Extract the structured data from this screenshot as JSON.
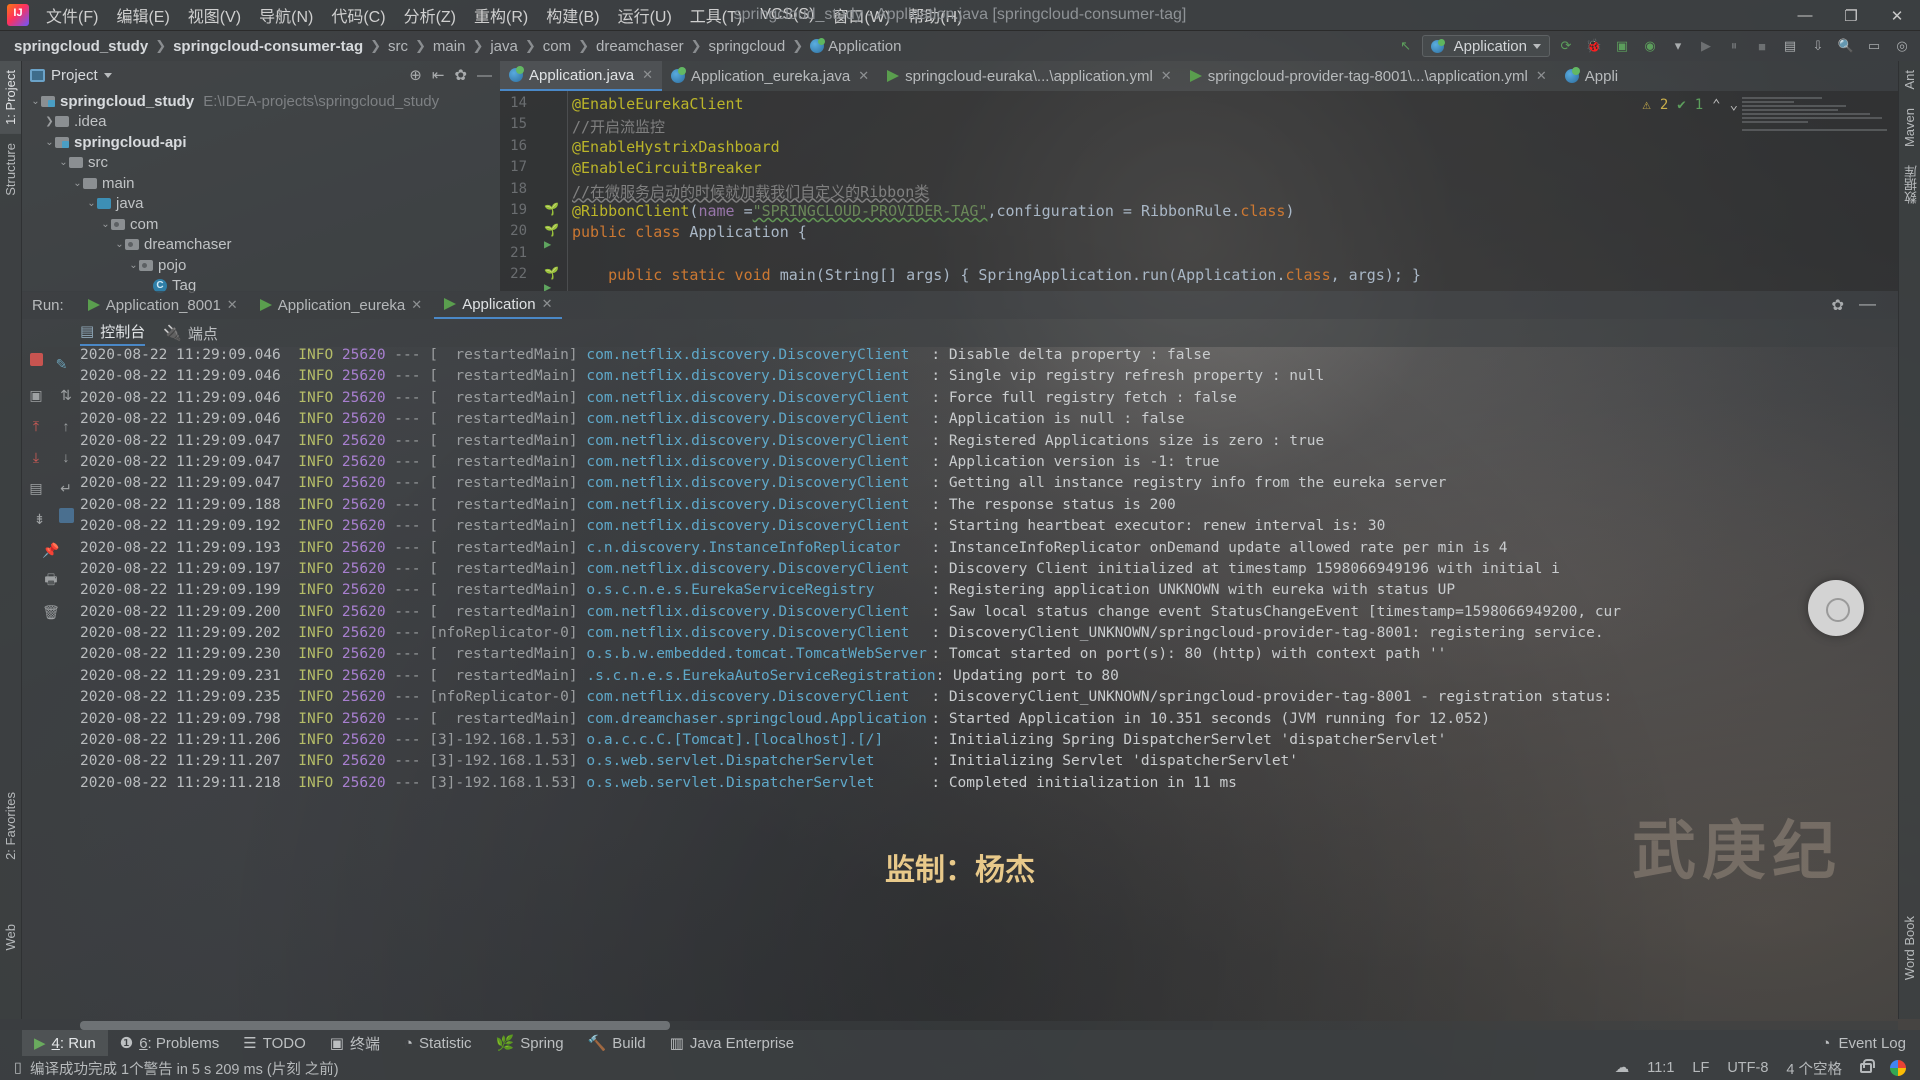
{
  "menubar": {
    "logo": "intellij-logo",
    "items": [
      "文件(F)",
      "编辑(E)",
      "视图(V)",
      "导航(N)",
      "代码(C)",
      "分析(Z)",
      "重构(R)",
      "构建(B)",
      "运行(U)",
      "工具(T)",
      "VCS(S)",
      "窗口(W)",
      "帮助(H)"
    ],
    "window_title": "springcloud_study - Application.java [springcloud-consumer-tag]",
    "window_controls": [
      "—",
      "❐",
      "✕"
    ]
  },
  "navbar": {
    "crumbs": [
      "springcloud_study",
      "springcloud-consumer-tag",
      "src",
      "main",
      "java",
      "com",
      "dreamchaser",
      "springcloud",
      "Application"
    ],
    "separator": "❯",
    "run_config": "Application",
    "toolbar_icons": [
      "back-arrow-icon",
      "rerun-icon",
      "debug-icon",
      "coverage-icon",
      "profile-icon",
      "run-icon",
      "pause-icon",
      "stop-icon",
      "layout-icon",
      "search-icon",
      "settings-icon",
      "help-icon"
    ]
  },
  "left_strip": {
    "tabs": [
      "1: Project",
      "Structure",
      "2: Favorites",
      "Web"
    ]
  },
  "right_strip": {
    "tabs": [
      "Ant",
      "Maven",
      "数据库",
      "Word Book"
    ]
  },
  "project_panel": {
    "title": "Project",
    "header_icons": [
      "locate-icon",
      "collapse-all-icon",
      "settings-icon",
      "hide-icon"
    ],
    "tree": [
      {
        "depth": 0,
        "arrow": "⌄",
        "icon": "module-folder",
        "label": "springcloud_study",
        "bold": true,
        "path": "E:\\IDEA-projects\\springcloud_study"
      },
      {
        "depth": 1,
        "arrow": "❯",
        "icon": "folder",
        "label": ".idea",
        "bold": false,
        "path": ""
      },
      {
        "depth": 1,
        "arrow": "⌄",
        "icon": "module-folder",
        "label": "springcloud-api",
        "bold": true,
        "path": ""
      },
      {
        "depth": 2,
        "arrow": "⌄",
        "icon": "folder",
        "label": "src",
        "bold": false,
        "path": ""
      },
      {
        "depth": 3,
        "arrow": "⌄",
        "icon": "folder",
        "label": "main",
        "bold": false,
        "path": ""
      },
      {
        "depth": 4,
        "arrow": "⌄",
        "icon": "source-folder",
        "label": "java",
        "bold": false,
        "path": ""
      },
      {
        "depth": 5,
        "arrow": "⌄",
        "icon": "package",
        "label": "com",
        "bold": false,
        "path": ""
      },
      {
        "depth": 6,
        "arrow": "⌄",
        "icon": "package",
        "label": "dreamchaser",
        "bold": false,
        "path": ""
      },
      {
        "depth": 7,
        "arrow": "⌄",
        "icon": "package",
        "label": "pojo",
        "bold": false,
        "path": ""
      },
      {
        "depth": 8,
        "arrow": "",
        "icon": "class",
        "label": "Tag",
        "bold": false,
        "path": ""
      }
    ]
  },
  "editor_tabs": [
    {
      "label": "Application.java",
      "icon": "java-class-icon",
      "selected": true,
      "closable": true
    },
    {
      "label": "Application_eureka.java",
      "icon": "java-class-icon",
      "selected": false,
      "closable": true
    },
    {
      "label": "springcloud-euraka\\...\\application.yml",
      "icon": "yaml-icon",
      "selected": false,
      "closable": true
    },
    {
      "label": "springcloud-provider-tag-8001\\...\\application.yml",
      "icon": "yaml-icon",
      "selected": false,
      "closable": true
    },
    {
      "label": "Appli",
      "icon": "java-class-icon",
      "selected": false,
      "closable": false
    }
  ],
  "editor": {
    "inspection": {
      "warnings": "2",
      "oks": "1",
      "warn_icon": "warning-triangle-icon",
      "ok_icon": "check-icon",
      "up_icon": "⌃",
      "down_icon": "⌄"
    },
    "lines": [
      {
        "num": "14",
        "gutter": "",
        "tokens": [
          {
            "t": "@EnableEurekaClient",
            "c": "ann"
          }
        ]
      },
      {
        "num": "15",
        "gutter": "",
        "tokens": [
          {
            "t": "//开启流监控",
            "c": "cmt"
          }
        ]
      },
      {
        "num": "16",
        "gutter": "",
        "tokens": [
          {
            "t": "@EnableHystrixDashboard",
            "c": "ann"
          }
        ]
      },
      {
        "num": "17",
        "gutter": "",
        "tokens": [
          {
            "t": "@EnableCircuitBreaker",
            "c": "ann"
          }
        ]
      },
      {
        "num": "18",
        "gutter": "",
        "tokens": [
          {
            "t": "//在微服务启动的时候就加载我们自定义的Ribbon类",
            "c": "cmt-u"
          }
        ]
      },
      {
        "num": "19",
        "gutter": "bean-icon",
        "tokens": [
          {
            "t": "@RibbonClient",
            "c": "ann"
          },
          {
            "t": "(",
            "c": "pln"
          },
          {
            "t": "name ",
            "c": "fld"
          },
          {
            "t": "=",
            "c": "pln"
          },
          {
            "t": "\"SPRINGCLOUD-PROVIDER-TAG\"",
            "c": "str sq-und"
          },
          {
            "t": ",",
            "c": "pln"
          },
          {
            "t": "configuration = ",
            "c": "pln"
          },
          {
            "t": "RibbonRule",
            "c": "pln"
          },
          {
            "t": ".",
            "c": "pln"
          },
          {
            "t": "class",
            "c": "kw"
          },
          {
            "t": ")",
            "c": "pln"
          }
        ]
      },
      {
        "num": "20",
        "gutter": "run-icon",
        "tokens": [
          {
            "t": "public class ",
            "c": "kw"
          },
          {
            "t": "Application",
            "c": "pln"
          },
          {
            "t": " {",
            "c": "pln"
          }
        ]
      },
      {
        "num": "21",
        "gutter": "",
        "tokens": []
      },
      {
        "num": "22",
        "gutter": "run-icon",
        "tokens": [
          {
            "t": "    public static void ",
            "c": "kw"
          },
          {
            "t": "main",
            "c": "cls2"
          },
          {
            "t": "(",
            "c": "pln"
          },
          {
            "t": "String",
            "c": "pln"
          },
          {
            "t": "[] args) { ",
            "c": "pln"
          },
          {
            "t": "SpringApplication",
            "c": "pln"
          },
          {
            "t": ".",
            "c": "pln"
          },
          {
            "t": "run",
            "c": "cls2"
          },
          {
            "t": "(",
            "c": "pln"
          },
          {
            "t": "Application",
            "c": "pln"
          },
          {
            "t": ".",
            "c": "pln"
          },
          {
            "t": "class",
            "c": "kw"
          },
          {
            "t": ", args); }",
            "c": "pln"
          }
        ]
      }
    ]
  },
  "run_panel": {
    "label": "Run:",
    "tabs": [
      {
        "label": "Application_8001",
        "icon": "run-tab-icon",
        "selected": false
      },
      {
        "label": "Application_eureka",
        "icon": "run-tab-icon",
        "selected": false
      },
      {
        "label": "Application",
        "icon": "run-tab-icon",
        "selected": true
      }
    ],
    "settings_icon": "gear-icon",
    "minimize_icon": "minimize-icon",
    "subtabs": [
      {
        "label": "控制台",
        "icon": "console-icon",
        "selected": true
      },
      {
        "label": "端点",
        "icon": "endpoints-icon",
        "selected": false
      }
    ],
    "side_icons": [
      "rerun-icon",
      "edit-icon",
      "stop-icon",
      "sort-icon",
      "camera-icon",
      "up-arrow-icon",
      "export-icon",
      "down-arrow-icon",
      "import-icon",
      "scroll-end-icon",
      "layout-icon",
      "wrap-icon",
      "pin-icon",
      "print-icon",
      "trash-icon"
    ]
  },
  "console_logs": [
    {
      "date": "2020-08-22 11:29:09.046",
      "level": "INFO",
      "pid": "25620",
      "thread": "[  restartedMain]",
      "logger": "com.netflix.discovery.DiscoveryClient",
      "msg": ": Disable delta property : false"
    },
    {
      "date": "2020-08-22 11:29:09.046",
      "level": "INFO",
      "pid": "25620",
      "thread": "[  restartedMain]",
      "logger": "com.netflix.discovery.DiscoveryClient",
      "msg": ": Single vip registry refresh property : null"
    },
    {
      "date": "2020-08-22 11:29:09.046",
      "level": "INFO",
      "pid": "25620",
      "thread": "[  restartedMain]",
      "logger": "com.netflix.discovery.DiscoveryClient",
      "msg": ": Force full registry fetch : false"
    },
    {
      "date": "2020-08-22 11:29:09.046",
      "level": "INFO",
      "pid": "25620",
      "thread": "[  restartedMain]",
      "logger": "com.netflix.discovery.DiscoveryClient",
      "msg": ": Application is null : false"
    },
    {
      "date": "2020-08-22 11:29:09.047",
      "level": "INFO",
      "pid": "25620",
      "thread": "[  restartedMain]",
      "logger": "com.netflix.discovery.DiscoveryClient",
      "msg": ": Registered Applications size is zero : true"
    },
    {
      "date": "2020-08-22 11:29:09.047",
      "level": "INFO",
      "pid": "25620",
      "thread": "[  restartedMain]",
      "logger": "com.netflix.discovery.DiscoveryClient",
      "msg": ": Application version is -1: true"
    },
    {
      "date": "2020-08-22 11:29:09.047",
      "level": "INFO",
      "pid": "25620",
      "thread": "[  restartedMain]",
      "logger": "com.netflix.discovery.DiscoveryClient",
      "msg": ": Getting all instance registry info from the eureka server"
    },
    {
      "date": "2020-08-22 11:29:09.188",
      "level": "INFO",
      "pid": "25620",
      "thread": "[  restartedMain]",
      "logger": "com.netflix.discovery.DiscoveryClient",
      "msg": ": The response status is 200"
    },
    {
      "date": "2020-08-22 11:29:09.192",
      "level": "INFO",
      "pid": "25620",
      "thread": "[  restartedMain]",
      "logger": "com.netflix.discovery.DiscoveryClient",
      "msg": ": Starting heartbeat executor: renew interval is: 30"
    },
    {
      "date": "2020-08-22 11:29:09.193",
      "level": "INFO",
      "pid": "25620",
      "thread": "[  restartedMain]",
      "logger": "c.n.discovery.InstanceInfoReplicator",
      "msg": ": InstanceInfoReplicator onDemand update allowed rate per min is 4"
    },
    {
      "date": "2020-08-22 11:29:09.197",
      "level": "INFO",
      "pid": "25620",
      "thread": "[  restartedMain]",
      "logger": "com.netflix.discovery.DiscoveryClient",
      "msg": ": Discovery Client initialized at timestamp 1598066949196 with initial i"
    },
    {
      "date": "2020-08-22 11:29:09.199",
      "level": "INFO",
      "pid": "25620",
      "thread": "[  restartedMain]",
      "logger": "o.s.c.n.e.s.EurekaServiceRegistry",
      "msg": ": Registering application UNKNOWN with eureka with status UP"
    },
    {
      "date": "2020-08-22 11:29:09.200",
      "level": "INFO",
      "pid": "25620",
      "thread": "[  restartedMain]",
      "logger": "com.netflix.discovery.DiscoveryClient",
      "msg": ": Saw local status change event StatusChangeEvent [timestamp=1598066949200, cur"
    },
    {
      "date": "2020-08-22 11:29:09.202",
      "level": "INFO",
      "pid": "25620",
      "thread": "[nfoReplicator-0]",
      "logger": "com.netflix.discovery.DiscoveryClient",
      "msg": ": DiscoveryClient_UNKNOWN/springcloud-provider-tag-8001: registering service."
    },
    {
      "date": "2020-08-22 11:29:09.230",
      "level": "INFO",
      "pid": "25620",
      "thread": "[  restartedMain]",
      "logger": "o.s.b.w.embedded.tomcat.TomcatWebServer",
      "msg": ": Tomcat started on port(s): 80 (http) with context path ''"
    },
    {
      "date": "2020-08-22 11:29:09.231",
      "level": "INFO",
      "pid": "25620",
      "thread": "[  restartedMain]",
      "logger": ".s.c.n.e.s.EurekaAutoServiceRegistration",
      "msg": ": Updating port to 80"
    },
    {
      "date": "2020-08-22 11:29:09.235",
      "level": "INFO",
      "pid": "25620",
      "thread": "[nfoReplicator-0]",
      "logger": "com.netflix.discovery.DiscoveryClient",
      "msg": ": DiscoveryClient_UNKNOWN/springcloud-provider-tag-8001 - registration status:"
    },
    {
      "date": "2020-08-22 11:29:09.798",
      "level": "INFO",
      "pid": "25620",
      "thread": "[  restartedMain]",
      "logger": "com.dreamchaser.springcloud.Application",
      "msg": ": Started Application in 10.351 seconds (JVM running for 12.052)"
    },
    {
      "date": "2020-08-22 11:29:11.206",
      "level": "INFO",
      "pid": "25620",
      "thread": "[3]-192.168.1.53]",
      "logger": "o.a.c.c.C.[Tomcat].[localhost].[/]",
      "msg": ": Initializing Spring DispatcherServlet 'dispatcherServlet'"
    },
    {
      "date": "2020-08-22 11:29:11.207",
      "level": "INFO",
      "pid": "25620",
      "thread": "[3]-192.168.1.53]",
      "logger": "o.s.web.servlet.DispatcherServlet",
      "msg": ": Initializing Servlet 'dispatcherServlet'"
    },
    {
      "date": "2020-08-22 11:29:11.218",
      "level": "INFO",
      "pid": "25620",
      "thread": "[3]-192.168.1.53]",
      "logger": "o.s.web.servlet.DispatcherServlet",
      "msg": ": Completed initialization in 11 ms"
    }
  ],
  "bottom_bar": {
    "items": [
      {
        "label": "4: Run",
        "underline": "4",
        "icon": "run-icon",
        "selected": true
      },
      {
        "label": "6: Problems",
        "underline": "6",
        "icon": "problems-icon",
        "selected": false
      },
      {
        "label": "TODO",
        "underline": "",
        "icon": "todo-icon",
        "selected": false
      },
      {
        "label": "终端",
        "underline": "",
        "icon": "terminal-icon",
        "selected": false
      },
      {
        "label": "Statistic",
        "underline": "",
        "icon": "statistic-icon",
        "selected": false
      },
      {
        "label": "Spring",
        "underline": "",
        "icon": "spring-leaf-icon",
        "selected": false
      },
      {
        "label": "Build",
        "underline": "",
        "icon": "build-hammer-icon",
        "selected": false
      },
      {
        "label": "Java Enterprise",
        "underline": "",
        "icon": "java-enterprise-icon",
        "selected": false
      }
    ],
    "event_log": {
      "label": "Event Log",
      "icon": "event-log-icon"
    }
  },
  "status_bar": {
    "message": "编译成功完成 1个警告 in 5 s 209 ms (片刻 之前)",
    "message_icon": "build-status-icon",
    "right": {
      "cloud_icon": "cloud-settings-icon",
      "caret": "11:1",
      "line_sep": "LF",
      "encoding": "UTF-8",
      "indent": "4 个空格",
      "lock_icon": "unlocked-icon",
      "google_icon": "google-icon"
    }
  },
  "watermark": {
    "title": "武庚纪",
    "subtitle": "监制：杨杰"
  }
}
